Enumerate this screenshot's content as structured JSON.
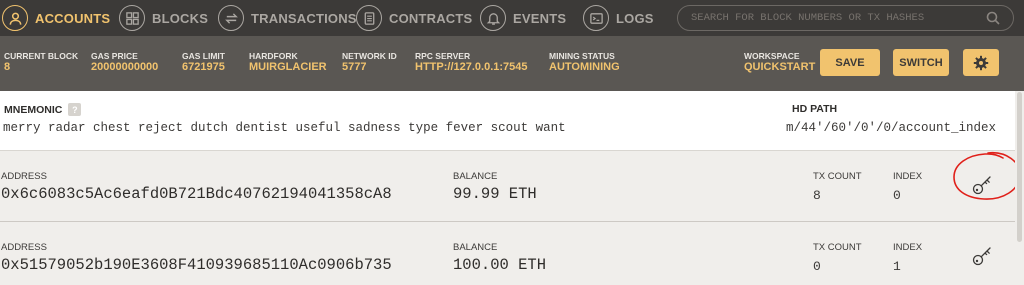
{
  "nav": {
    "items": [
      {
        "label": "ACCOUNTS",
        "icon": "account-icon"
      },
      {
        "label": "BLOCKS",
        "icon": "blocks-icon"
      },
      {
        "label": "TRANSACTIONS",
        "icon": "transactions-icon"
      },
      {
        "label": "CONTRACTS",
        "icon": "contracts-icon"
      },
      {
        "label": "EVENTS",
        "icon": "bell-icon"
      },
      {
        "label": "LOGS",
        "icon": "terminal-icon"
      }
    ],
    "search_placeholder": "SEARCH FOR BLOCK NUMBERS OR TX HASHES"
  },
  "status": {
    "current_block": {
      "label": "CURRENT BLOCK",
      "value": "8"
    },
    "gas_price": {
      "label": "GAS PRICE",
      "value": "20000000000"
    },
    "gas_limit": {
      "label": "GAS LIMIT",
      "value": "6721975"
    },
    "hardfork": {
      "label": "HARDFORK",
      "value": "MUIRGLACIER"
    },
    "network_id": {
      "label": "NETWORK ID",
      "value": "5777"
    },
    "rpc_server": {
      "label": "RPC SERVER",
      "value": "HTTP://127.0.0.1:7545"
    },
    "mining_status": {
      "label": "MINING STATUS",
      "value": "AUTOMINING"
    },
    "workspace": {
      "label": "WORKSPACE",
      "value": "QUICKSTART"
    },
    "save_label": "SAVE",
    "switch_label": "SWITCH"
  },
  "mnemonic": {
    "label": "MNEMONIC",
    "help": "?",
    "phrase": "merry radar chest reject dutch dentist useful sadness type fever scout want",
    "hd_path_label": "HD PATH",
    "hd_path": "m/44'/60'/0'/0/account_index"
  },
  "accounts": [
    {
      "address_label": "ADDRESS",
      "address": "0x6c6083c5Ac6eafd0B721Bdc40762194041358cA8",
      "balance_label": "BALANCE",
      "balance": "99.99 ETH",
      "tx_count_label": "TX COUNT",
      "tx_count": "8",
      "index_label": "INDEX",
      "index": "0"
    },
    {
      "address_label": "ADDRESS",
      "address": "0x51579052b190E3608F410939685110Ac0906b735",
      "balance_label": "BALANCE",
      "balance": "100.00 ETH",
      "tx_count_label": "TX COUNT",
      "tx_count": "0",
      "index_label": "INDEX",
      "index": "1"
    }
  ],
  "colors": {
    "nav_bg": "#3c3a38",
    "status_bg": "#5a5753",
    "accent": "#f1c36e",
    "annotation": "#e0201a"
  }
}
